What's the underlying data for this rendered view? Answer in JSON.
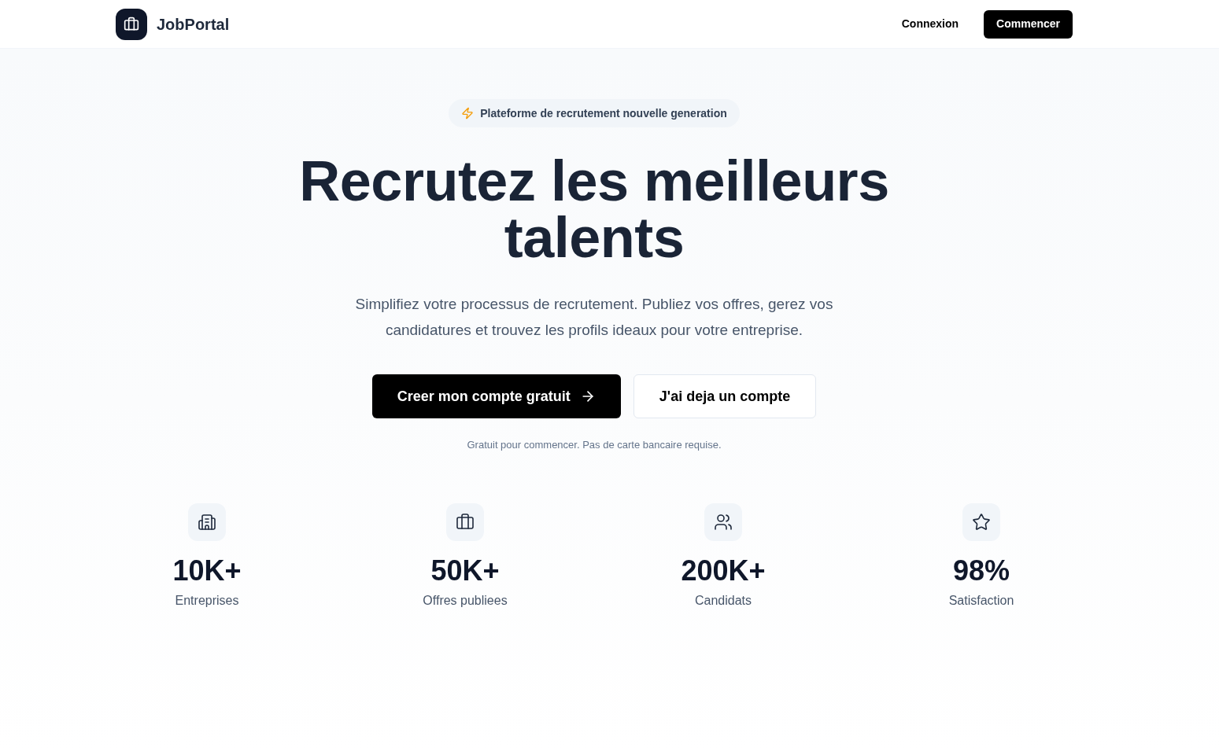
{
  "header": {
    "logo_text": "JobPortal",
    "nav": [
      {
        "label": "Connexion",
        "kind": "link"
      },
      {
        "label": "Commencer",
        "kind": "primary"
      }
    ]
  },
  "hero": {
    "badge": "Plateforme de recrutement nouvelle generation",
    "title": "Recrutez les meilleurs talents",
    "subtitle": "Simplifiez votre processus de recrutement. Publiez vos offres, gerez vos candidatures et trouvez les profils ideaux pour votre entreprise.",
    "buttons": [
      {
        "label": "Creer mon compte gratuit",
        "kind": "primary"
      },
      {
        "label": "J'ai deja un compte",
        "kind": "secondary"
      }
    ],
    "note": "Gratuit pour commencer. Pas de carte bancaire requise."
  },
  "stats": [
    {
      "kind": "building",
      "value": "10K+",
      "label": "Entreprises"
    },
    {
      "kind": "briefcase",
      "value": "50K+",
      "label": "Offres publiees"
    },
    {
      "kind": "users",
      "value": "200K+",
      "label": "Candidats"
    },
    {
      "kind": "star",
      "value": "98%",
      "label": "Satisfaction"
    }
  ]
}
